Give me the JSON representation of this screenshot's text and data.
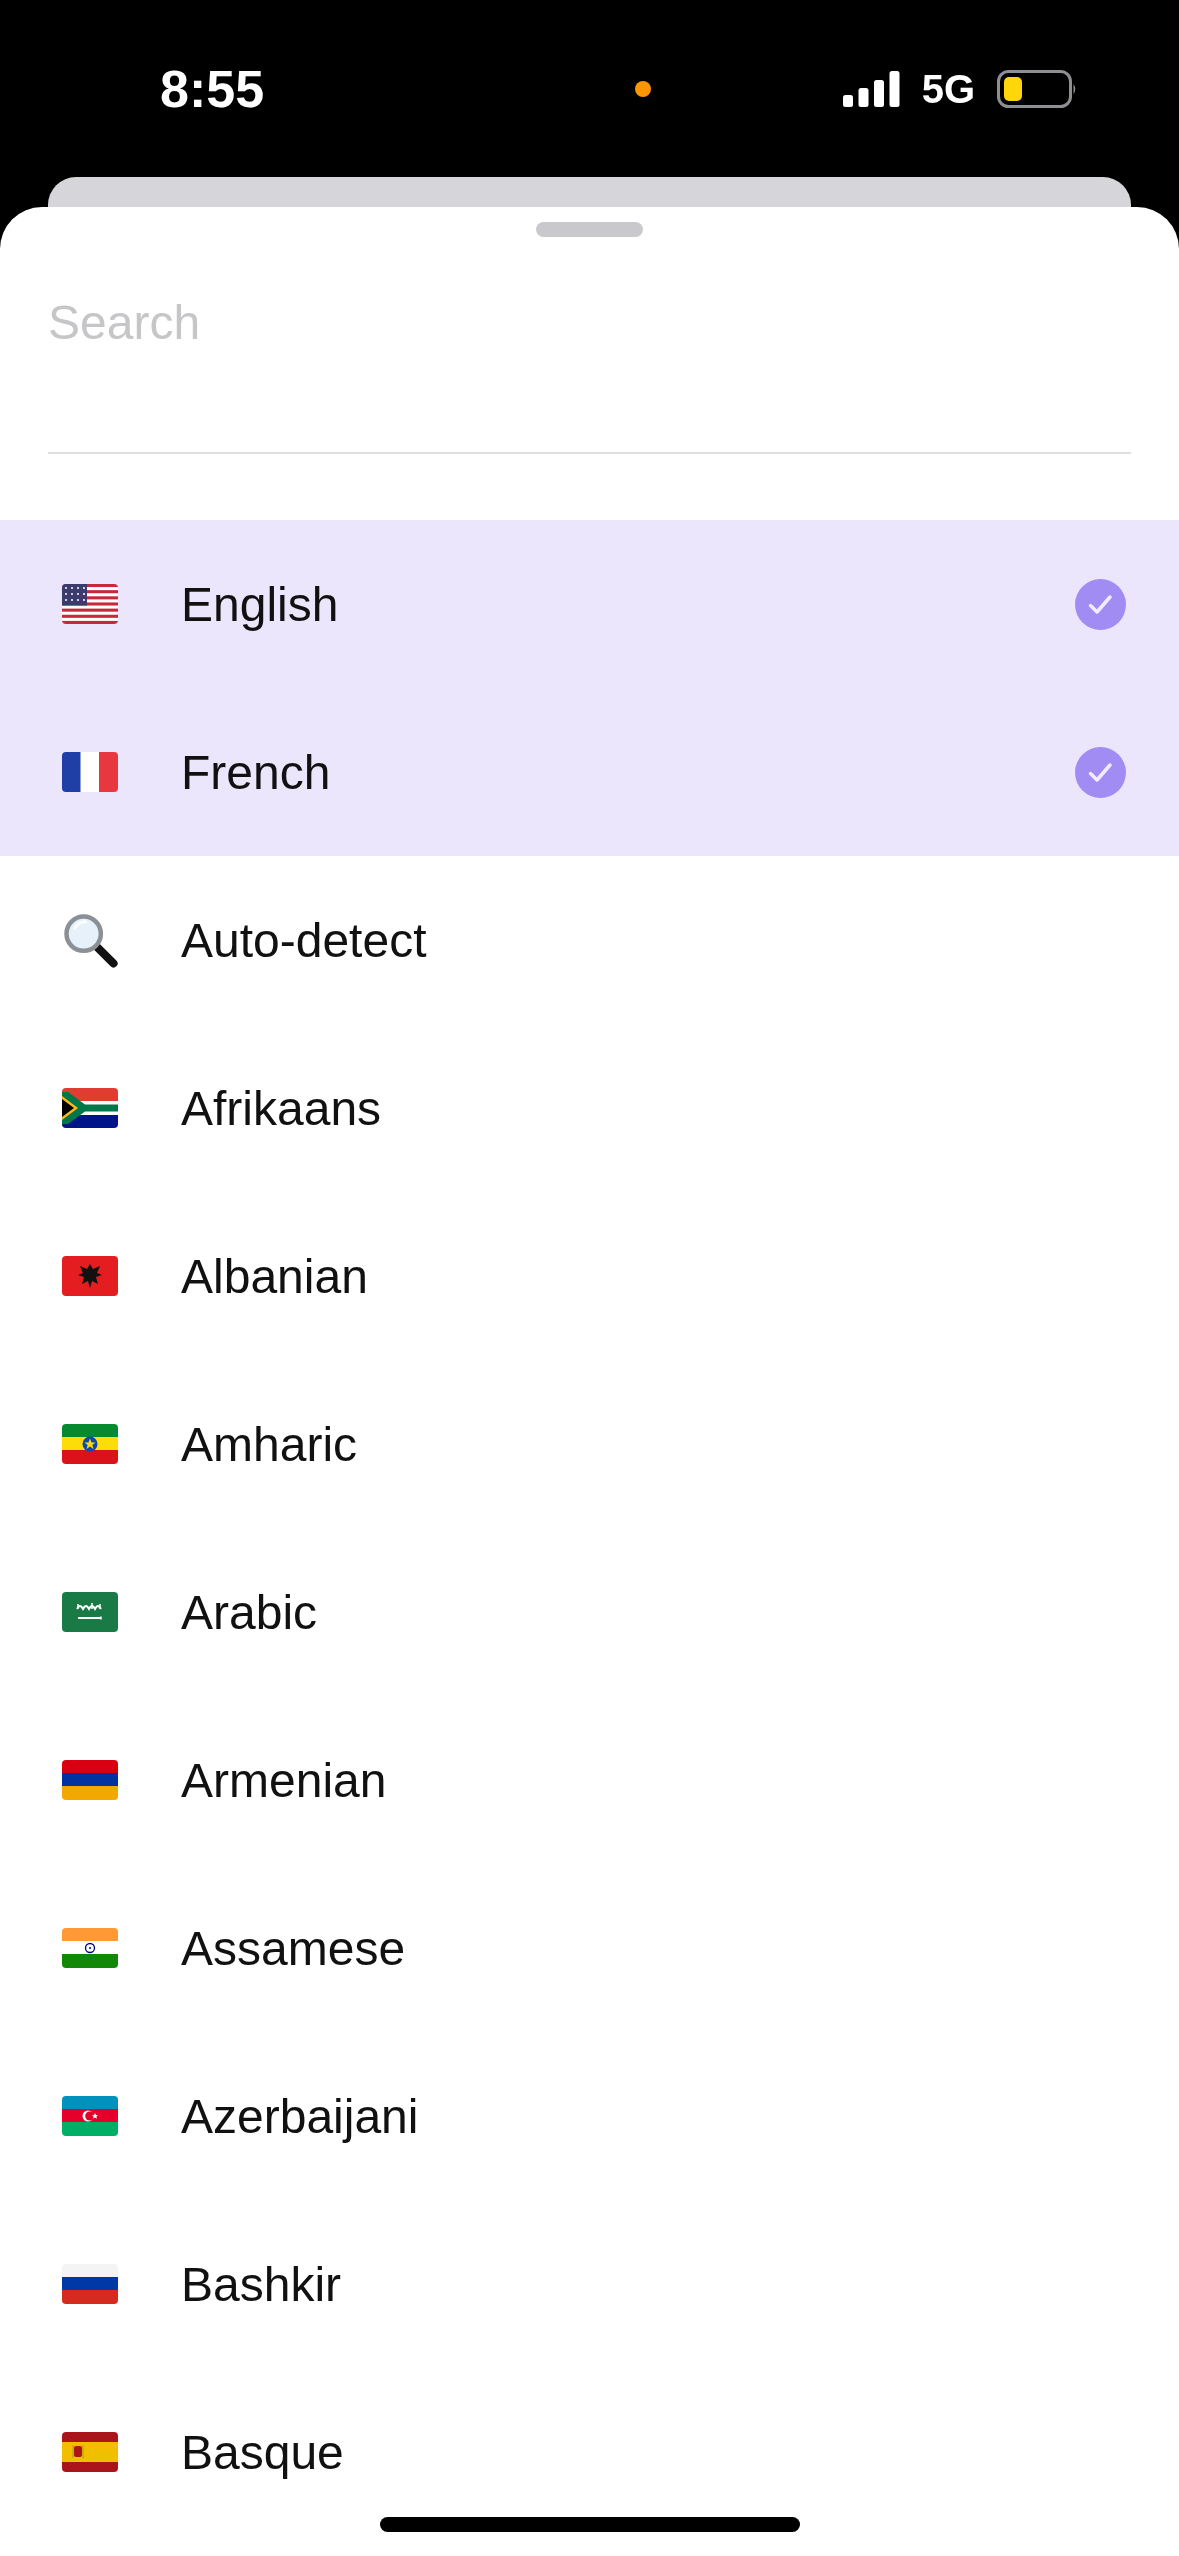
{
  "status_bar": {
    "time": "8:55",
    "network": "5G"
  },
  "search": {
    "placeholder": "Search"
  },
  "languages": [
    {
      "label": "English",
      "selected": true
    },
    {
      "label": "French",
      "selected": true
    },
    {
      "label": "Auto-detect",
      "selected": false
    },
    {
      "label": "Afrikaans",
      "selected": false
    },
    {
      "label": "Albanian",
      "selected": false
    },
    {
      "label": "Amharic",
      "selected": false
    },
    {
      "label": "Arabic",
      "selected": false
    },
    {
      "label": "Armenian",
      "selected": false
    },
    {
      "label": "Assamese",
      "selected": false
    },
    {
      "label": "Azerbaijani",
      "selected": false
    },
    {
      "label": "Bashkir",
      "selected": false
    },
    {
      "label": "Basque",
      "selected": false
    }
  ]
}
